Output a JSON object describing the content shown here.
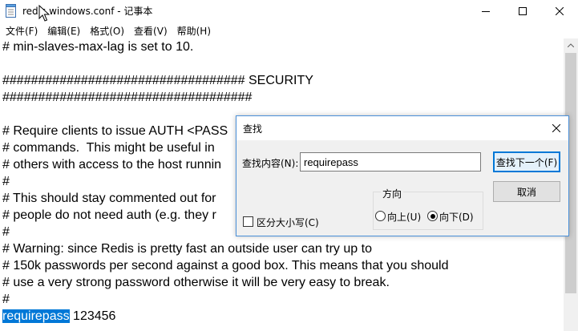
{
  "window": {
    "title": "redis.windows.conf - 记事本"
  },
  "menu": {
    "items": [
      {
        "label": "文件(F)"
      },
      {
        "label": "编辑(E)"
      },
      {
        "label": "格式(O)"
      },
      {
        "label": "查看(V)"
      },
      {
        "label": "帮助(H)"
      }
    ]
  },
  "editor": {
    "lines": [
      "# min-slaves-max-lag is set to 10.",
      "",
      "################################## SECURITY",
      "###################################",
      "",
      "# Require clients to issue AUTH <PASS",
      "# commands.  This might be useful in",
      "# others with access to the host runnin",
      "#",
      "# This should stay commented out for",
      "# people do not need auth (e.g. they r",
      "#",
      "# Warning: since Redis is pretty fast an outside user can try up to",
      "# 150k passwords per second against a good box. This means that you should",
      "# use a very strong password otherwise it will be very easy to break.",
      "#"
    ],
    "last_line_selected": "requirepass",
    "last_line_rest": " 123456"
  },
  "find_dialog": {
    "title": "查找",
    "find_label": "查找内容(N):",
    "find_value": "requirepass",
    "find_next_label": "查找下一个(F)",
    "cancel_label": "取消",
    "direction_label": "方向",
    "up_label": "向上(U)",
    "down_label": "向下(D)",
    "direction_selected": "down",
    "match_case_label": "区分大小写(C)",
    "match_case_checked": false
  },
  "icons": {
    "app": "notepad-icon",
    "minimize": "minimize-icon",
    "maximize": "maximize-icon",
    "close": "close-icon",
    "cursor": "mouse-cursor-icon"
  },
  "colors": {
    "selection": "#0078d7",
    "dialog_border": "#4a90d9",
    "primary_button_border": "#0078d7"
  }
}
